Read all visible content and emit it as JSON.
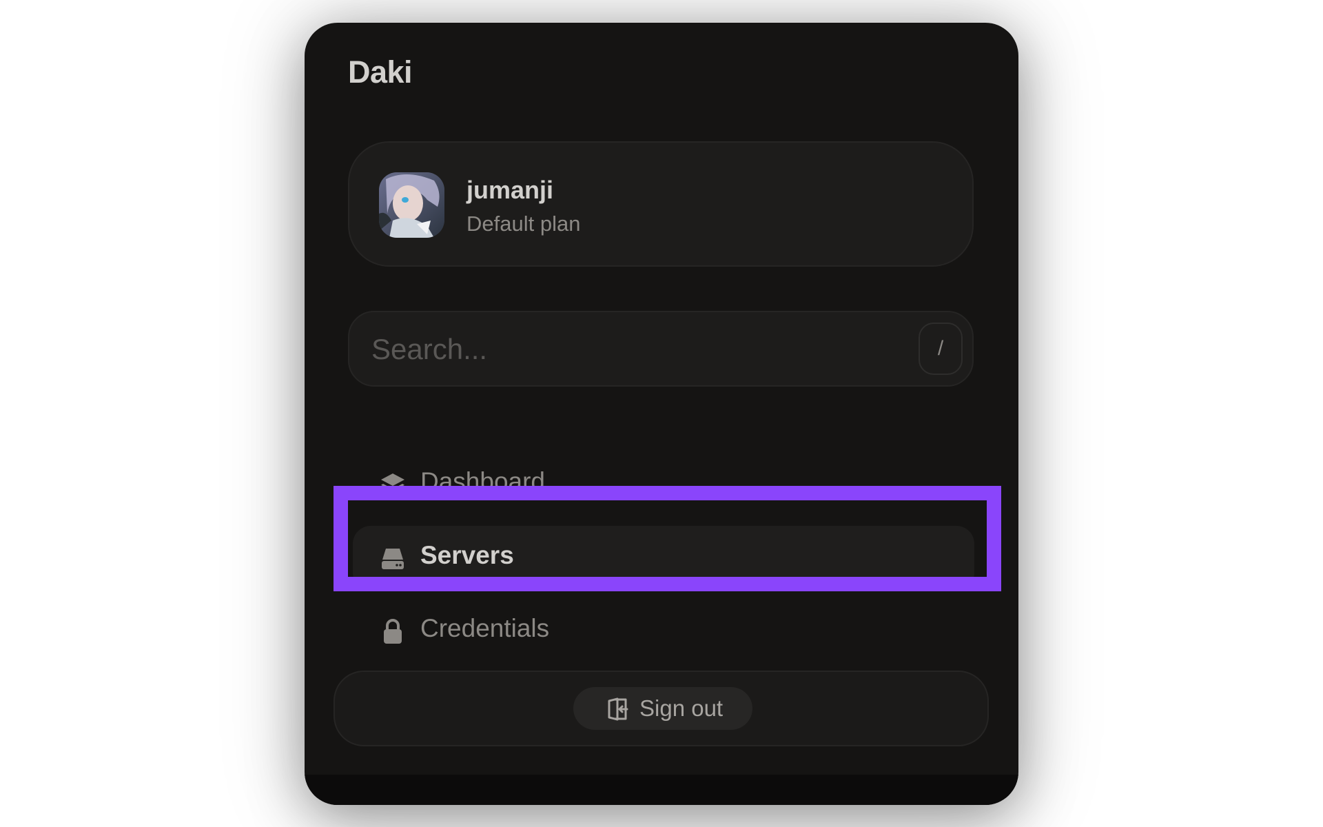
{
  "app": {
    "title": "Daki"
  },
  "profile": {
    "username": "jumanji",
    "plan": "Default plan",
    "avatar_icon": "anime-avatar-image"
  },
  "search": {
    "placeholder": "Search...",
    "value": "",
    "shortcut_hint": "/"
  },
  "nav": {
    "items": [
      {
        "label": "Dashboard",
        "icon": "layers-icon",
        "active": false
      },
      {
        "label": "Servers",
        "icon": "server-drive-icon",
        "active": true
      },
      {
        "label": "Credentials",
        "icon": "lock-icon",
        "active": false
      }
    ]
  },
  "footer": {
    "signout_label": "Sign out",
    "signout_icon": "sign-out-icon"
  },
  "colors": {
    "panel_bg": "#151413",
    "card_bg": "#1d1c1b",
    "text_primary": "#d2d0cd",
    "text_muted": "#8c8985",
    "highlight": "#8a45fb"
  }
}
